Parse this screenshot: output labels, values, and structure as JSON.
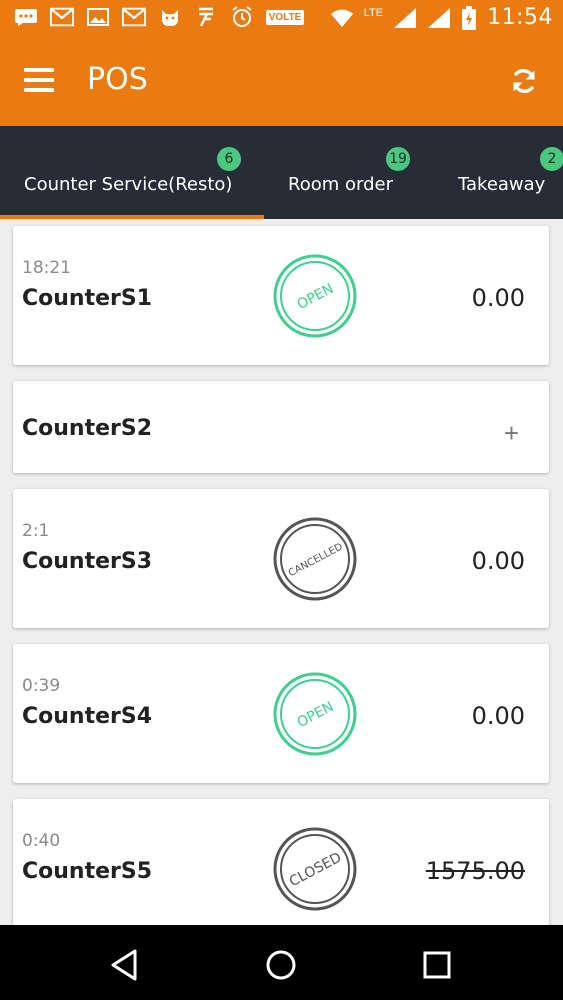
{
  "status_bar": {
    "time": "11:54",
    "volte": "VOLTE",
    "lte": "LTE",
    "icons": [
      "chat-icon",
      "gmail-icon",
      "image-icon",
      "gmail-icon",
      "cat-icon",
      "bolt-icon",
      "alarm-icon",
      "volte-icon",
      "wifi-icon",
      "signal-icon",
      "signal-icon",
      "battery-icon"
    ]
  },
  "app_bar": {
    "title": "POS",
    "menu_icon": "menu-icon",
    "refresh_icon": "refresh-icon",
    "color": "#ea7a12"
  },
  "tabs": [
    {
      "label": "Counter Service(Resto)",
      "count": "6",
      "active": true
    },
    {
      "label": "Room order",
      "count": "19",
      "active": false
    },
    {
      "label": "Takeaway",
      "count": "2",
      "active": false
    }
  ],
  "colors": {
    "accent": "#ea7a12",
    "tabs_bg": "#262d36",
    "badge": "#4cc780",
    "open_stamp": "#3fcf8e",
    "closed_stamp": "#555555"
  },
  "counters": [
    {
      "time": "18:21",
      "name": "CounterS1",
      "status": "OPEN",
      "amount": "0.00",
      "struck": false
    },
    {
      "time": "",
      "name": "CounterS2",
      "status": "",
      "amount": "",
      "add": "+"
    },
    {
      "time": "2:1",
      "name": "CounterS3",
      "status": "CANCELLED",
      "amount": "0.00",
      "struck": false
    },
    {
      "time": "0:39",
      "name": "CounterS4",
      "status": "OPEN",
      "amount": "0.00",
      "struck": false
    },
    {
      "time": "0:40",
      "name": "CounterS5",
      "status": "CLOSED",
      "amount": "1575.00",
      "struck": true
    }
  ],
  "nav_bar": {
    "icons": [
      "back-icon",
      "home-icon",
      "recents-icon"
    ]
  }
}
